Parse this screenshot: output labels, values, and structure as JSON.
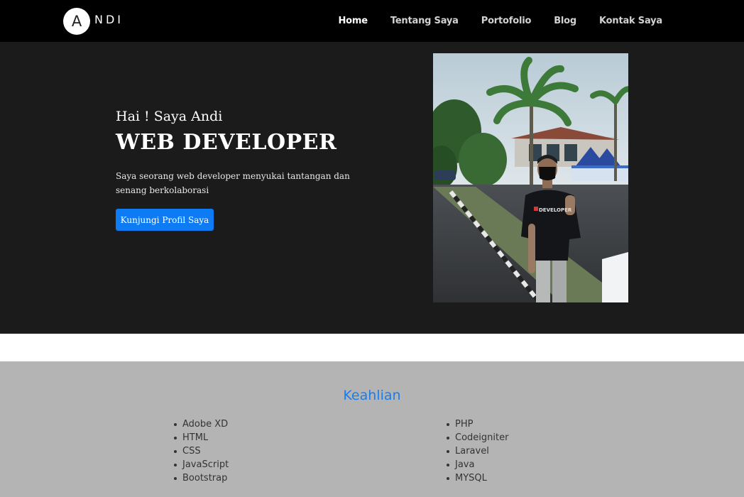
{
  "navbar": {
    "logo_letter": "A",
    "logo_rest": "NDI",
    "links": [
      {
        "label": "Home",
        "active": true
      },
      {
        "label": "Tentang Saya",
        "active": false
      },
      {
        "label": "Portofolio",
        "active": false
      },
      {
        "label": "Blog",
        "active": false
      },
      {
        "label": "Kontak Saya",
        "active": false
      }
    ]
  },
  "hero": {
    "greeting": "Hai ! Saya Andi",
    "title": "WEB DEVELOPER",
    "description": "Saya seorang web developer menyukai tantangan dan senang berkolaborasi",
    "button_label": "Kunjungi Profil Saya",
    "photo_shirt_text": "DEVELOPER"
  },
  "skills": {
    "title": "Keahlian",
    "left": [
      "Adobe XD",
      "HTML",
      "CSS",
      "JavaScript",
      "Bootstrap"
    ],
    "right": [
      "PHP",
      "Codeigniter",
      "Laravel",
      "Java",
      "MYSQL"
    ]
  },
  "colors": {
    "navbar_bg": "#000000",
    "hero_bg": "#1b1b1c",
    "button_bg": "#0d7cf4",
    "skills_bg": "#b4b4b4",
    "skills_title": "#1a7ee8"
  }
}
